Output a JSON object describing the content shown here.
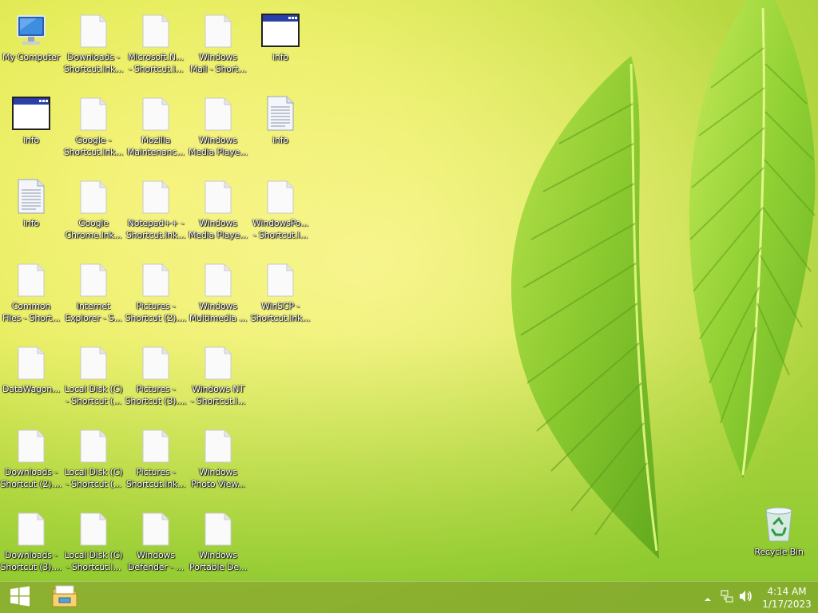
{
  "desktop": {
    "icons": [
      {
        "label": "My Computer",
        "icon": "computer-icon"
      },
      {
        "label": "Downloads -\nShortcut.lnk...",
        "icon": "file-icon"
      },
      {
        "label": "Microsoft.N...\n- Shortcut.l...",
        "icon": "file-icon"
      },
      {
        "label": "Windows\nMail - Short...",
        "icon": "file-icon"
      },
      {
        "label": "info",
        "icon": "window-icon"
      },
      {
        "label": "info",
        "icon": "window-icon"
      },
      {
        "label": "Google -\nShortcut.lnk...",
        "icon": "file-icon"
      },
      {
        "label": "Mozilla\nMaintenanc...",
        "icon": "file-icon"
      },
      {
        "label": "Windows\nMedia Playe...",
        "icon": "file-icon"
      },
      {
        "label": "info",
        "icon": "text-file-icon"
      },
      {
        "label": "info",
        "icon": "text-file-icon"
      },
      {
        "label": "Google\nChrome.lnk...",
        "icon": "file-icon"
      },
      {
        "label": "Notepad++ -\nShortcut.lnk...",
        "icon": "file-icon"
      },
      {
        "label": "Windows\nMedia Playe...",
        "icon": "file-icon"
      },
      {
        "label": "WindowsPo...\n- Shortcut.l...",
        "icon": "file-icon"
      },
      {
        "label": "Common\nFiles - Short...",
        "icon": "file-icon"
      },
      {
        "label": "Internet\nExplorer - S...",
        "icon": "file-icon"
      },
      {
        "label": "Pictures -\nShortcut (2)....",
        "icon": "file-icon"
      },
      {
        "label": "Windows\nMultimedia ...",
        "icon": "file-icon"
      },
      {
        "label": "WinSCP -\nShortcut.lnk...",
        "icon": "file-icon"
      },
      {
        "label": "DataWagon...",
        "icon": "file-icon"
      },
      {
        "label": "Local Disk (C)\n- Shortcut (...",
        "icon": "file-icon"
      },
      {
        "label": "Pictures -\nShortcut (3)....",
        "icon": "file-icon"
      },
      {
        "label": "Windows NT\n- Shortcut.l...",
        "icon": "file-icon"
      },
      {
        "label": "Downloads -\nShortcut (2)....",
        "icon": "file-icon"
      },
      {
        "label": "Local Disk (C)\n- Shortcut (...",
        "icon": "file-icon"
      },
      {
        "label": "Pictures -\nShortcut.lnk...",
        "icon": "file-icon"
      },
      {
        "label": "Windows\nPhoto View...",
        "icon": "file-icon"
      },
      {
        "label": "Downloads -\nShortcut (3)....",
        "icon": "file-icon"
      },
      {
        "label": "Local Disk (C)\n- Shortcut.l...",
        "icon": "file-icon"
      },
      {
        "label": "Windows\nDefender - ...",
        "icon": "file-icon"
      },
      {
        "label": "Windows\nPortable De...",
        "icon": "file-icon"
      },
      {
        "label": "Recycle Bin",
        "icon": "recycle-bin-icon"
      }
    ]
  },
  "taskbar": {
    "start_icon": "windows-logo-icon",
    "pinned": [
      {
        "icon": "file-explorer-icon"
      }
    ],
    "tray": {
      "show_hidden_icon": "chevron-up-icon",
      "network_icon": "network-icon",
      "volume_icon": "speaker-icon",
      "time": "4:14 AM",
      "date": "1/17/2023"
    }
  },
  "colors": {
    "wallpaper_light": "#f2f06a",
    "wallpaper_green": "#a9d23c",
    "leaf": "#7cc22a",
    "taskbar": "#78a028"
  }
}
